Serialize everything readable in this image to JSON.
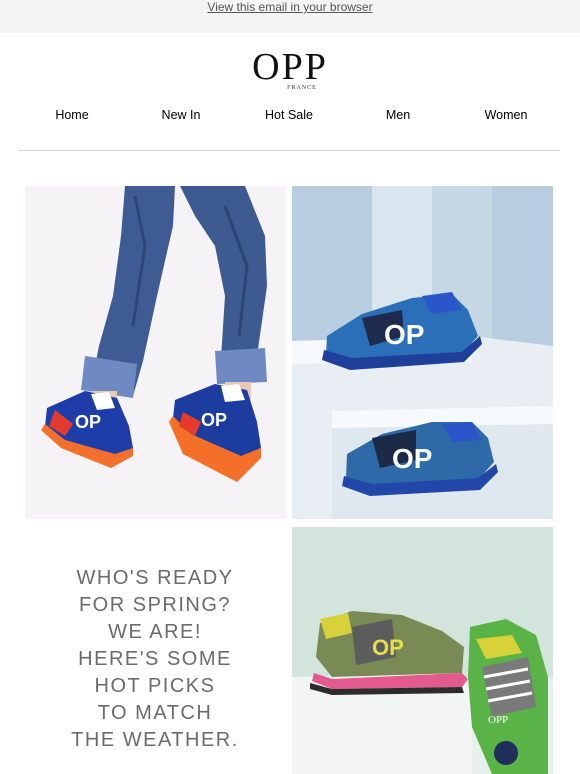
{
  "header": {
    "view_in_browser": "View this email in your browser",
    "brand": "OPP",
    "brand_sub": "FRANCE"
  },
  "nav": {
    "items": [
      {
        "label": "Home"
      },
      {
        "label": "New In"
      },
      {
        "label": "Hot Sale"
      },
      {
        "label": "Men"
      },
      {
        "label": "Women"
      }
    ]
  },
  "promo": {
    "lines": [
      "WHO'S READY",
      "FOR SPRING?",
      "WE ARE!",
      "HERE'S SOME",
      "HOT PICKS",
      "TO MATCH",
      "THE WEATHER."
    ]
  },
  "images": {
    "jeans_sneakers": {
      "logo_mark": "OP"
    },
    "blue_sneakers": {
      "logo_mark": "OP"
    },
    "green_sneakers": {
      "logo_mark": "OPP"
    }
  },
  "colors": {
    "topbar": "#f4f4f4",
    "divider": "#d6d6d6",
    "tagline": "#6b6b6b"
  }
}
